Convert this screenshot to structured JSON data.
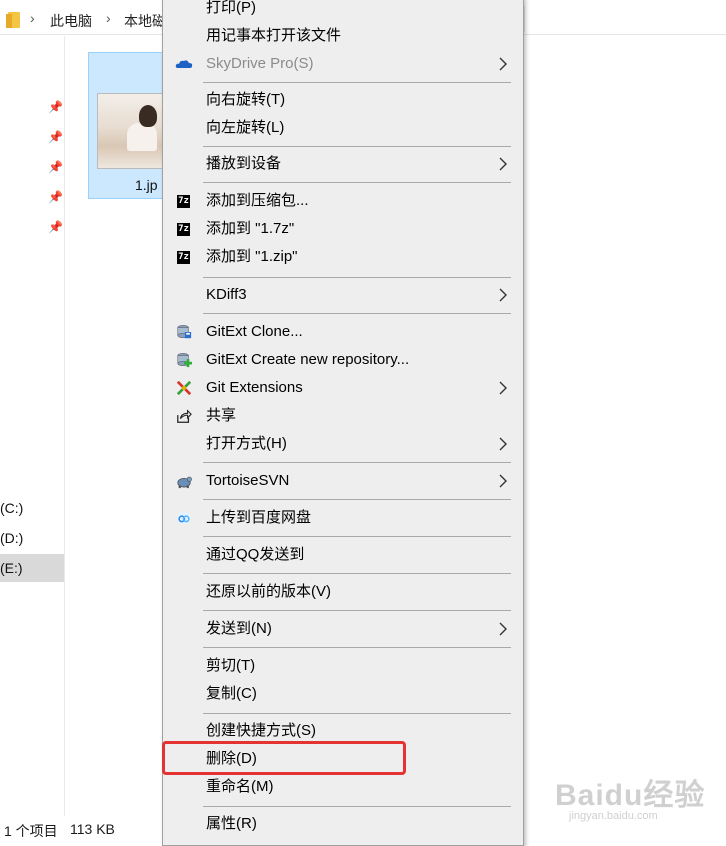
{
  "address_bar": {
    "crumbs": [
      "此电脑",
      "本地磁"
    ]
  },
  "nav": {
    "drives": [
      "(C:)",
      "(D:)",
      "(E:)"
    ]
  },
  "file": {
    "name": "1.jp"
  },
  "status": {
    "count": "1 个项目",
    "size": "113 KB"
  },
  "context_menu": {
    "items": [
      {
        "label": "打印(P)",
        "icon": "",
        "submenu": false
      },
      {
        "label": "用记事本打开该文件",
        "icon": "",
        "submenu": false
      },
      {
        "label": "SkyDrive Pro(S)",
        "icon": "cloud-icon",
        "submenu": true,
        "disabled": true
      },
      {
        "label": "向右旋转(T)",
        "icon": "",
        "submenu": false
      },
      {
        "label": "向左旋转(L)",
        "icon": "",
        "submenu": false
      },
      {
        "label": "播放到设备",
        "icon": "",
        "submenu": true
      },
      {
        "label": "添加到压缩包...",
        "icon": "7zip-icon",
        "submenu": false
      },
      {
        "label": "添加到 \"1.7z\"",
        "icon": "7zip-icon",
        "submenu": false
      },
      {
        "label": "添加到 \"1.zip\"",
        "icon": "7zip-icon",
        "submenu": false
      },
      {
        "label": "KDiff3",
        "icon": "",
        "submenu": true
      },
      {
        "label": "GitExt Clone...",
        "icon": "git-clone-icon",
        "submenu": false
      },
      {
        "label": "GitExt Create new repository...",
        "icon": "git-create-icon",
        "submenu": false
      },
      {
        "label": "Git Extensions",
        "icon": "git-extensions-icon",
        "submenu": true
      },
      {
        "label": "共享",
        "icon": "share-icon",
        "submenu": false
      },
      {
        "label": "打开方式(H)",
        "icon": "",
        "submenu": true
      },
      {
        "label": "TortoiseSVN",
        "icon": "tortoise-svn-icon",
        "submenu": true
      },
      {
        "label": "上传到百度网盘",
        "icon": "baidu-netdisk-icon",
        "submenu": false
      },
      {
        "label": "通过QQ发送到",
        "icon": "",
        "submenu": false
      },
      {
        "label": "还原以前的版本(V)",
        "icon": "",
        "submenu": false
      },
      {
        "label": "发送到(N)",
        "icon": "",
        "submenu": true
      },
      {
        "label": "剪切(T)",
        "icon": "",
        "submenu": false
      },
      {
        "label": "复制(C)",
        "icon": "",
        "submenu": false
      },
      {
        "label": "创建快捷方式(S)",
        "icon": "",
        "submenu": false
      },
      {
        "label": "删除(D)",
        "icon": "",
        "submenu": false,
        "highlighted": true
      },
      {
        "label": "重命名(M)",
        "icon": "",
        "submenu": false
      },
      {
        "label": "属性(R)",
        "icon": "",
        "submenu": false
      }
    ],
    "zip_badge": "7z"
  },
  "colors": {
    "menu_bg": "#eeeeee",
    "highlight_border": "#e53333",
    "selection_bg": "#cce8ff"
  },
  "watermark": {
    "brand": "Baidu经验",
    "url": "jingyan.baidu.com"
  }
}
